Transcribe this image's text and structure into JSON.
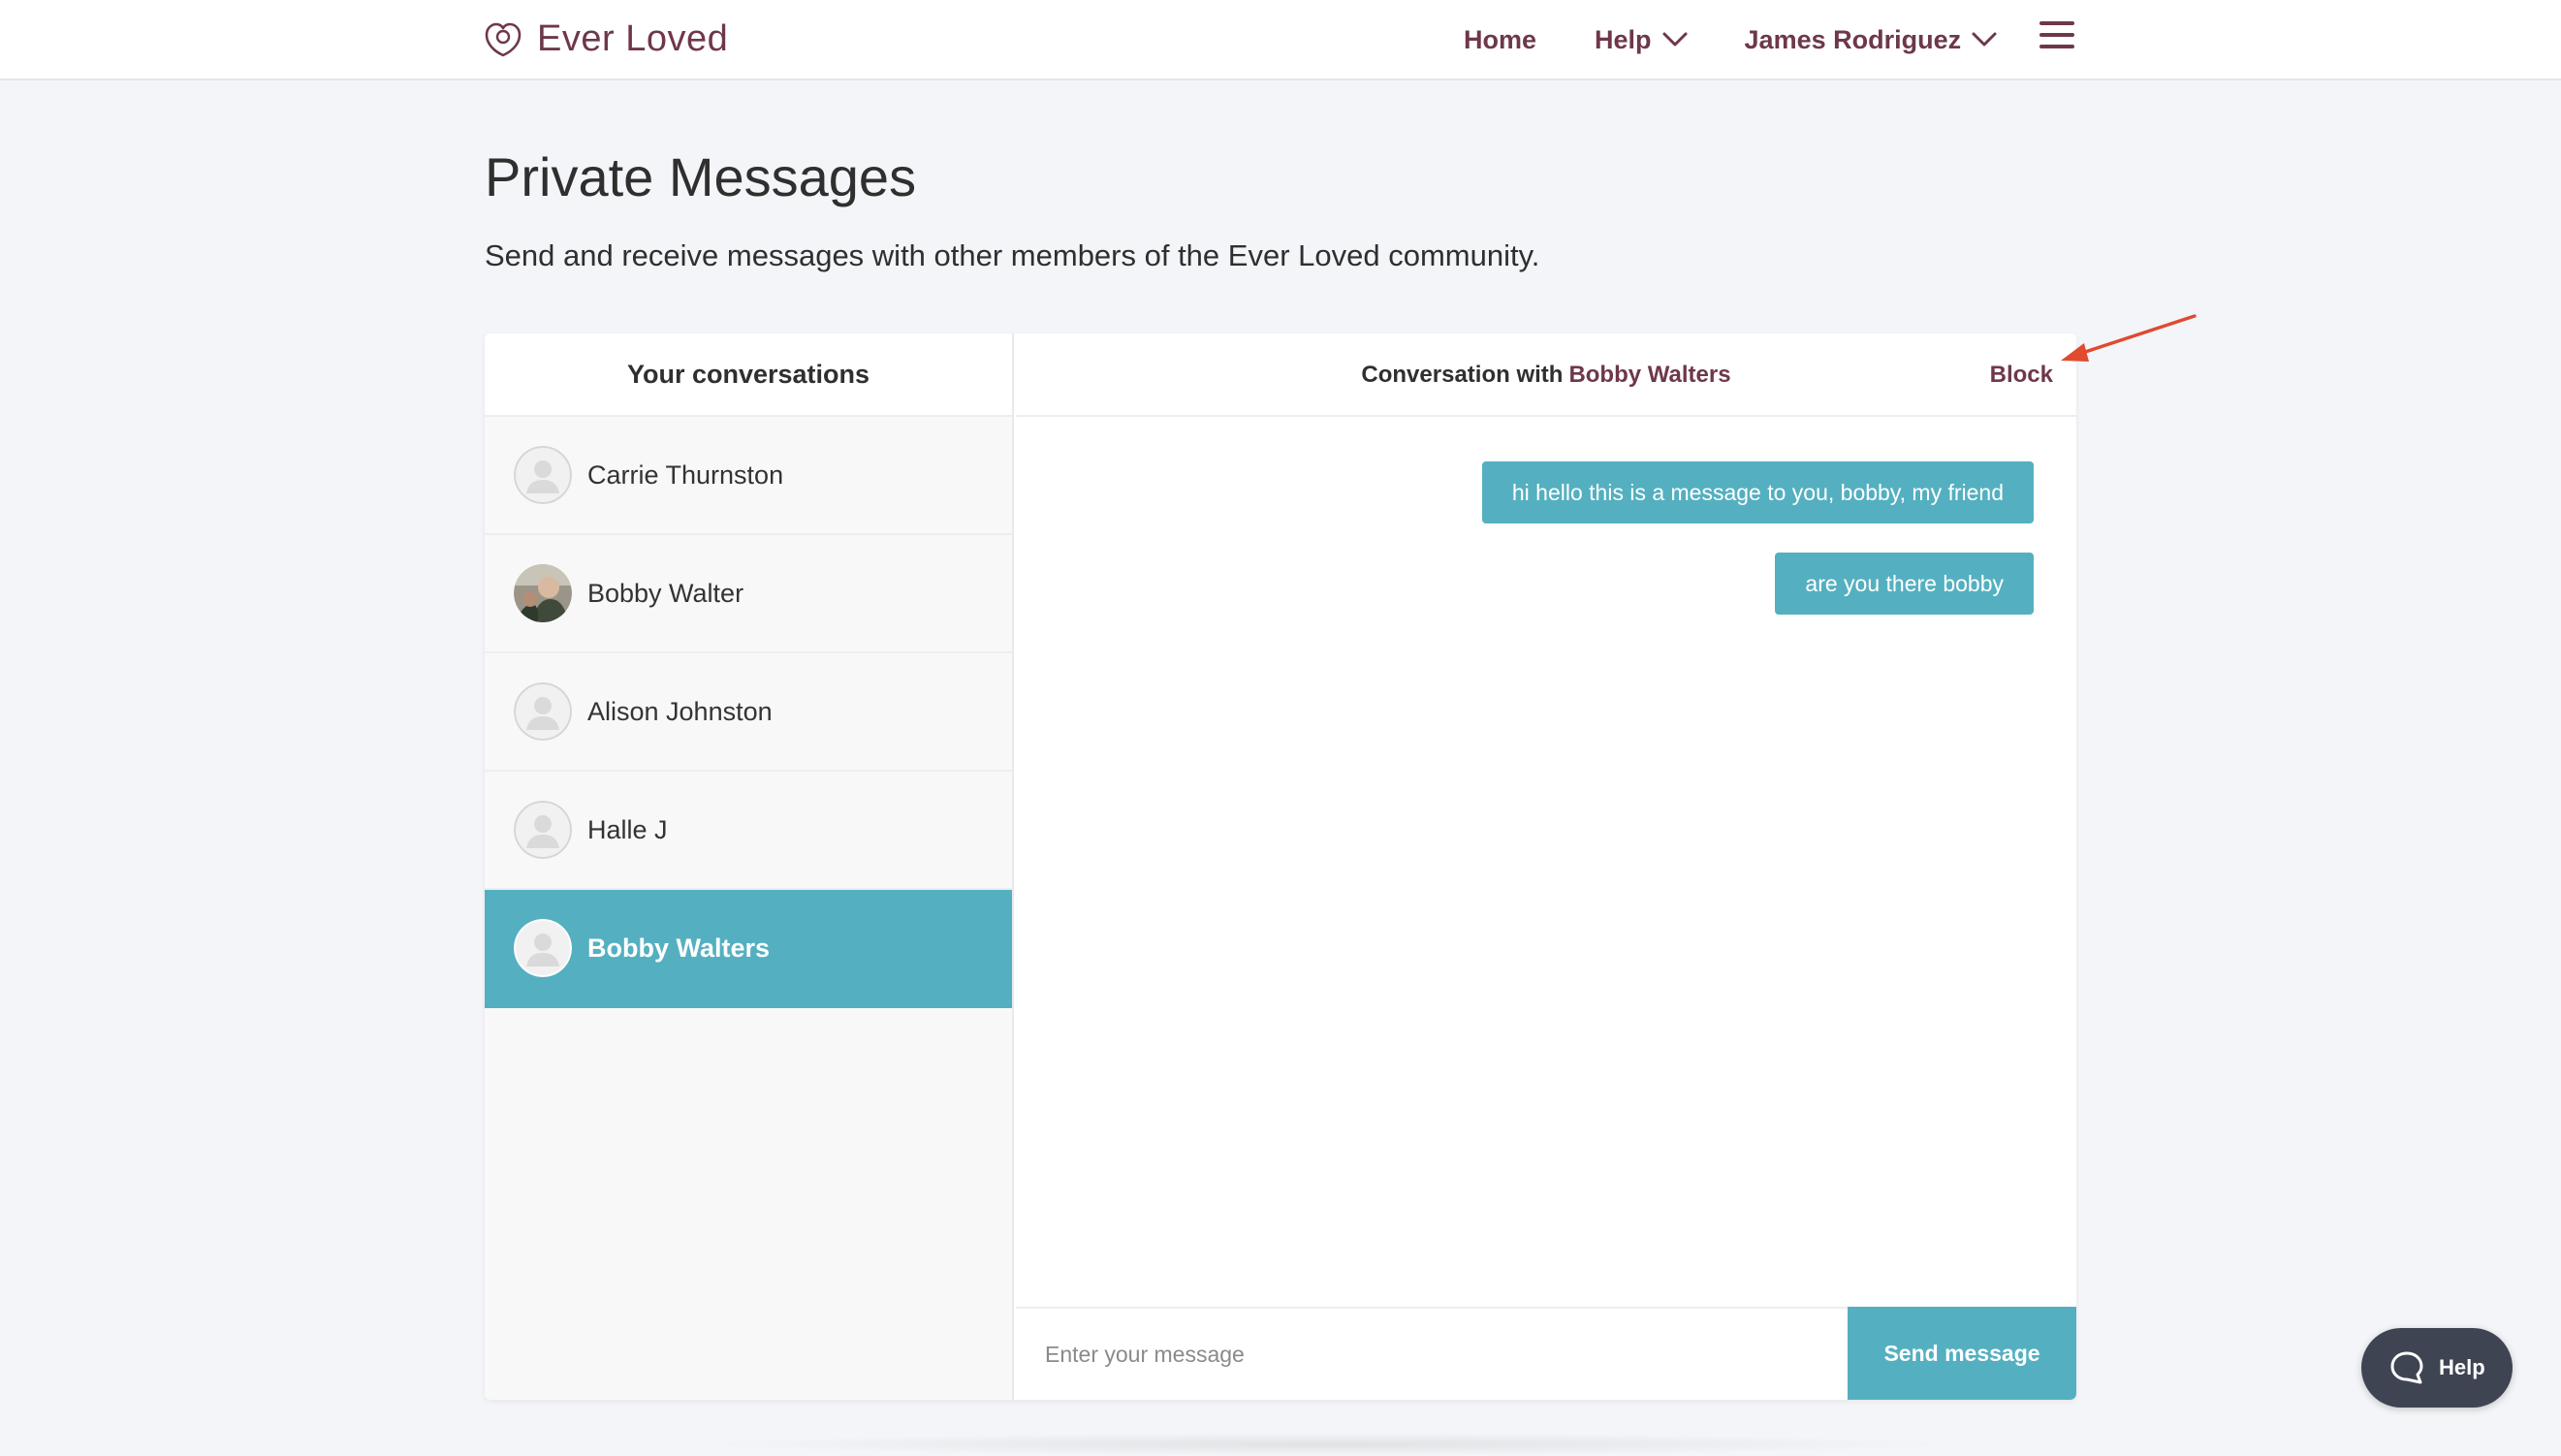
{
  "header": {
    "brand": "Ever Loved",
    "nav": {
      "home": "Home",
      "help": "Help",
      "user": "James Rodriguez"
    }
  },
  "intro": {
    "title": "Private Messages",
    "description": "Send and receive messages with other members of the Ever Loved community."
  },
  "sidebar": {
    "title": "Your conversations",
    "conversations": [
      {
        "name": "Carrie Thurnston",
        "avatar": "default-avatar-icon",
        "active": false
      },
      {
        "name": "Bobby Walter",
        "avatar": "photo-avatar",
        "active": false
      },
      {
        "name": "Alison Johnston",
        "avatar": "default-avatar-icon",
        "active": false
      },
      {
        "name": "Halle J",
        "avatar": "default-avatar-icon",
        "active": false
      },
      {
        "name": "Bobby Walters",
        "avatar": "default-avatar-icon",
        "active": true
      }
    ]
  },
  "thread": {
    "title_prefix": "Conversation with",
    "partner": "Bobby Walters",
    "block_label": "Block",
    "messages": [
      {
        "text": "hi hello this is a message to you, bobby, my friend"
      },
      {
        "text": "are you there bobby"
      }
    ],
    "composer": {
      "placeholder": "Enter your message",
      "value": "",
      "send_label": "Send message"
    }
  },
  "help_widget": {
    "label": "Help"
  },
  "colors": {
    "brand": "#6e3849",
    "accent": "#54b0c0",
    "background": "#f4f5f8",
    "annotation": "#e04a2f",
    "help_widget_bg": "#3e4452"
  }
}
